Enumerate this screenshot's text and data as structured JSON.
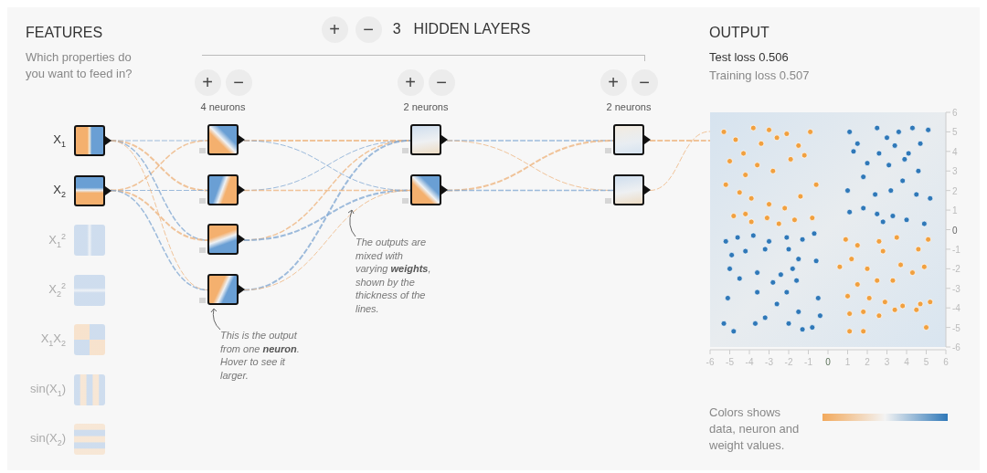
{
  "features": {
    "title": "FEATURES",
    "subtitle": "Which properties do you want to feed in?",
    "items": [
      {
        "label": "X$_{1}$",
        "kind": "x1",
        "selected": true
      },
      {
        "label": "X$_{2}$",
        "kind": "x2",
        "selected": true
      },
      {
        "label": "X$_{1}$$^{2}$",
        "kind": "x1sq",
        "selected": false
      },
      {
        "label": "X$_{2}$$^{2}$",
        "kind": "x2sq",
        "selected": false
      },
      {
        "label": "X$_{1}$X$_{2}$",
        "kind": "x1x2",
        "selected": false
      },
      {
        "label": "sin(X$_{1}$)",
        "kind": "sinx1",
        "selected": false
      },
      {
        "label": "sin(X$_{2}$)",
        "kind": "sinx2",
        "selected": false
      }
    ]
  },
  "hidden_layers": {
    "add_button": "+",
    "remove_button": "−",
    "count": "3",
    "title": "HIDDEN LAYERS",
    "layers": [
      {
        "add_button": "+",
        "remove_button": "−",
        "label": "4 neurons",
        "neurons": [
          {
            "kind": "falling"
          },
          {
            "kind": "rising"
          },
          {
            "kind": "tilted"
          },
          {
            "kind": "sloped"
          }
        ]
      },
      {
        "add_button": "+",
        "remove_button": "−",
        "label": "2 neurons",
        "neurons": [
          {
            "kind": "pale"
          },
          {
            "kind": "falling"
          }
        ]
      },
      {
        "add_button": "+",
        "remove_button": "−",
        "label": "2 neurons",
        "neurons": [
          {
            "kind": "blank"
          },
          {
            "kind": "pale"
          }
        ]
      }
    ]
  },
  "notes": [
    {
      "text": "This is the output from one **neuron**. Hover to see it larger."
    },
    {
      "text": "The outputs are mixed with varying **weights**, shown by the thickness of the lines."
    }
  ],
  "output": {
    "title": "OUTPUT",
    "test_loss": "Test loss 0.506",
    "training_loss": "Training loss 0.507",
    "chart_data": {
      "type": "scatter",
      "xlim": [
        -6,
        6
      ],
      "ylim": [
        -6,
        6
      ],
      "xticks": [
        {
          "value": -6,
          "label": "-6"
        },
        {
          "value": -5,
          "label": "-5"
        },
        {
          "value": -4,
          "label": "-4"
        },
        {
          "value": -3,
          "label": "-3"
        },
        {
          "value": -2,
          "label": "-2"
        },
        {
          "value": -1,
          "label": "-1"
        },
        {
          "value": 0,
          "label": "0"
        },
        {
          "value": 1,
          "label": "1"
        },
        {
          "value": 2,
          "label": "2"
        },
        {
          "value": 3,
          "label": "3"
        },
        {
          "value": 4,
          "label": "4"
        },
        {
          "value": 5,
          "label": "5"
        },
        {
          "value": 6,
          "label": "6"
        }
      ],
      "yticks": [
        {
          "value": -6,
          "label": "-6"
        },
        {
          "value": -5,
          "label": "-5"
        },
        {
          "value": -4,
          "label": "-4"
        },
        {
          "value": -3,
          "label": "-3"
        },
        {
          "value": -2,
          "label": "-2"
        },
        {
          "value": -1,
          "label": "-1"
        },
        {
          "value": 0,
          "label": "0"
        },
        {
          "value": 1,
          "label": "1"
        },
        {
          "value": 2,
          "label": "2"
        },
        {
          "value": 3,
          "label": "3"
        },
        {
          "value": 4,
          "label": "4"
        },
        {
          "value": 5,
          "label": "5"
        },
        {
          "value": 6,
          "label": "6"
        }
      ],
      "series": [
        {
          "color": "#f0a040",
          "x": [
            -5.3,
            -4.7,
            -4.3,
            -3.8,
            -3.4,
            -3.0,
            -2.6,
            -2.1,
            -1.5,
            -0.9,
            -5.0,
            -4.2,
            -3.6,
            -2.8,
            -1.9,
            -1.2,
            -0.6,
            -5.2,
            -4.5,
            -3.9,
            -3.0,
            -2.2,
            -1.4,
            -0.8,
            -4.8,
            -3.9,
            -3.1,
            -2.5,
            -1.7,
            -4.2,
            0.9,
            1.5,
            2.6,
            3.5,
            4.6,
            5.1,
            1.2,
            2.0,
            2.8,
            3.7,
            4.9,
            0.6,
            1.5,
            2.5,
            3.3,
            4.3,
            1.0,
            2.1,
            2.9,
            3.8,
            4.7,
            5.2,
            1.1,
            1.8,
            2.6,
            3.4,
            4.5,
            1.1,
            1.8,
            5.0
          ],
          "values": [
            5.0,
            4.6,
            3.9,
            5.2,
            4.4,
            5.1,
            4.7,
            4.9,
            4.3,
            5.0,
            3.5,
            2.8,
            3.3,
            3.0,
            3.6,
            3.8,
            2.3,
            2.3,
            1.9,
            1.6,
            1.3,
            1.1,
            1.7,
            0.6,
            0.7,
            0.4,
            0.6,
            0.3,
            0.5,
            0.8,
            -0.5,
            -0.8,
            -0.6,
            -0.4,
            -1.0,
            -0.5,
            -1.5,
            -2.0,
            -1.1,
            -1.8,
            -1.9,
            -1.9,
            -2.8,
            -2.6,
            -2.6,
            -2.2,
            -3.4,
            -3.5,
            -3.7,
            -3.9,
            -3.8,
            -3.7,
            -4.3,
            -4.2,
            -4.4,
            -4.1,
            -4.1,
            -5.2,
            -5.2,
            -5.0
          ]
        },
        {
          "color": "#2f78b8",
          "x": [
            1.1,
            1.5,
            2.5,
            3.0,
            3.6,
            4.3,
            5.1,
            1.3,
            2.6,
            3.4,
            4.1,
            4.7,
            2.0,
            3.1,
            3.9,
            4.6,
            1.8,
            3.8,
            1.0,
            2.4,
            3.2,
            4.5,
            5.2,
            1.1,
            1.8,
            2.5,
            3.3,
            4.0,
            4.9,
            2.8,
            -5.2,
            -4.6,
            -3.8,
            -3.0,
            -2.1,
            -1.3,
            -0.7,
            -4.9,
            -4.2,
            -3.2,
            -2.0,
            -1.5,
            -0.6,
            -5.0,
            -3.6,
            -2.4,
            -1.8,
            -4.5,
            -2.8,
            -1.6,
            -3.6,
            -2.1,
            -0.5,
            -5.1,
            -2.6,
            -1.5,
            -3.2,
            -0.4,
            -5.3,
            -4.8,
            -2.0,
            -1.3,
            -0.8,
            -3.7
          ],
          "values": [
            5.0,
            4.4,
            5.2,
            4.7,
            5.0,
            5.2,
            5.1,
            4.0,
            3.9,
            4.3,
            3.9,
            4.4,
            3.4,
            3.3,
            3.6,
            3.0,
            2.7,
            2.5,
            2.0,
            1.8,
            2.0,
            1.8,
            1.6,
            0.9,
            1.1,
            0.8,
            0.7,
            0.5,
            0.3,
            0.4,
            -0.6,
            -0.4,
            -0.3,
            -0.6,
            -0.4,
            -0.5,
            -0.2,
            -1.3,
            -1.1,
            -1.0,
            -1.0,
            -1.5,
            -1.6,
            -2.0,
            -2.2,
            -2.3,
            -2.0,
            -2.5,
            -2.7,
            -2.6,
            -3.2,
            -3.2,
            -3.5,
            -3.5,
            -3.8,
            -4.2,
            -4.5,
            -4.4,
            -4.8,
            -5.2,
            -4.8,
            -5.1,
            -5.0,
            -4.8
          ]
        }
      ]
    },
    "legend": "Colors shows data, neuron and weight values."
  }
}
